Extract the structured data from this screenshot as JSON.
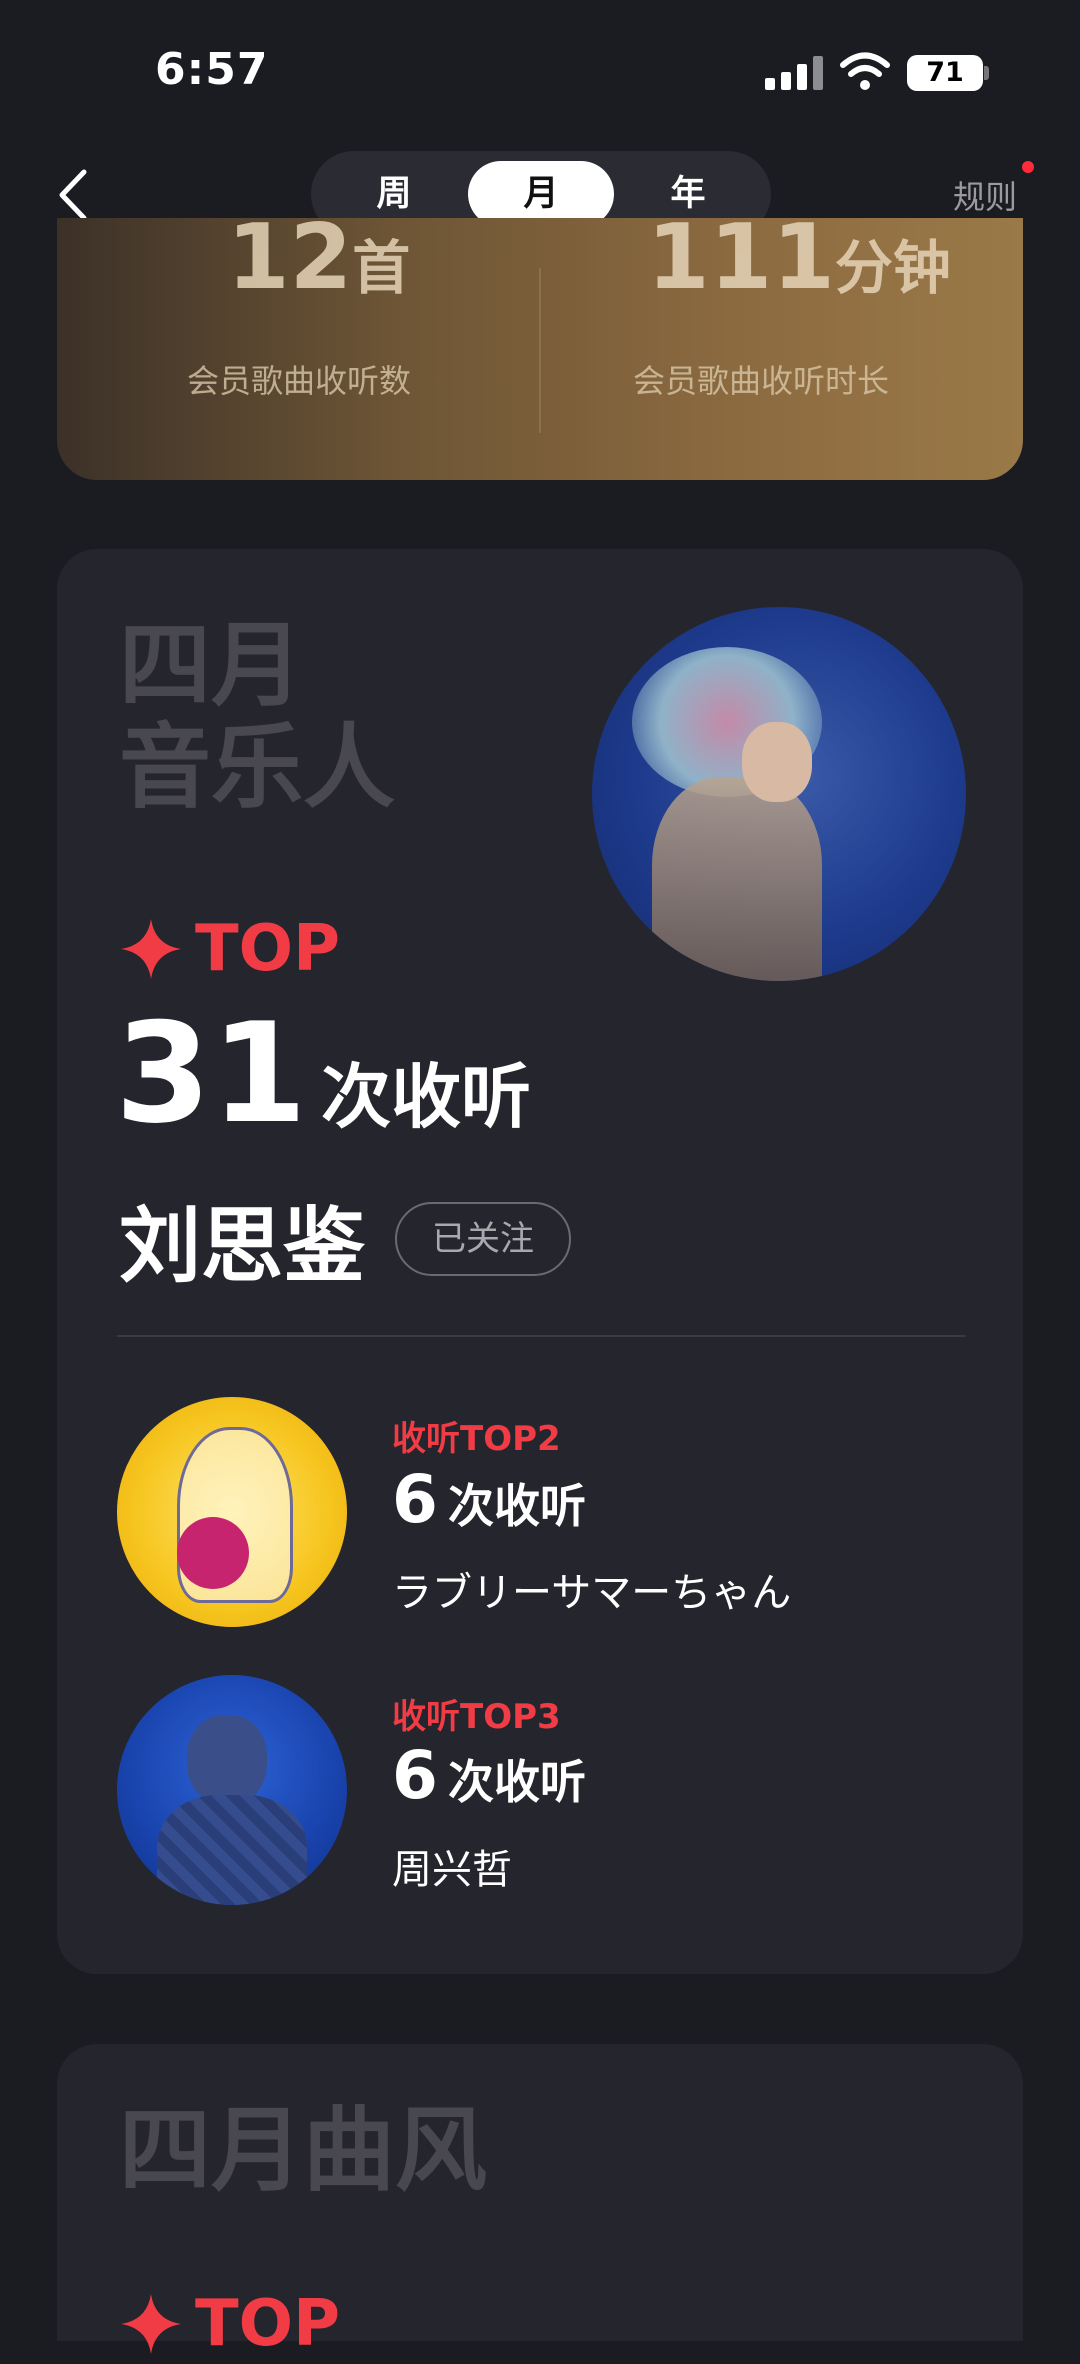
{
  "status_bar": {
    "time": "6:57",
    "battery": "71"
  },
  "nav": {
    "tabs": [
      {
        "label": "周",
        "active": false
      },
      {
        "label": "月",
        "active": true
      },
      {
        "label": "年",
        "active": false
      }
    ],
    "rules_label": "规则"
  },
  "member_stats": {
    "songs_value": "12",
    "songs_unit": "首",
    "songs_label": "会员歌曲收听数",
    "minutes_value": "111",
    "minutes_unit": "分钟",
    "minutes_label": "会员歌曲收听时长"
  },
  "artist_card": {
    "title_line1": "四月",
    "title_line2": "音乐人",
    "top_label": "TOP",
    "top_count": "31",
    "count_unit": "次收听",
    "artist_name": "刘思鉴",
    "follow_label": "已关注",
    "runners_up": [
      {
        "rank_label": "收听TOP2",
        "count": "6",
        "unit": "次收听",
        "name": "ラブリーサマーちゃん"
      },
      {
        "rank_label": "收听TOP3",
        "count": "6",
        "unit": "次收听",
        "name": "周兴哲"
      }
    ]
  },
  "genre_card": {
    "title": "四月曲风",
    "top_label": "TOP"
  },
  "colors": {
    "accent_red": "#f23c45",
    "background": "#1b1b22",
    "card": "#25252d",
    "gold": "#8c6a40"
  },
  "icons": [
    "back-chevron-icon",
    "signal-icon",
    "wifi-icon",
    "battery-icon",
    "sparkle-star-icon"
  ]
}
